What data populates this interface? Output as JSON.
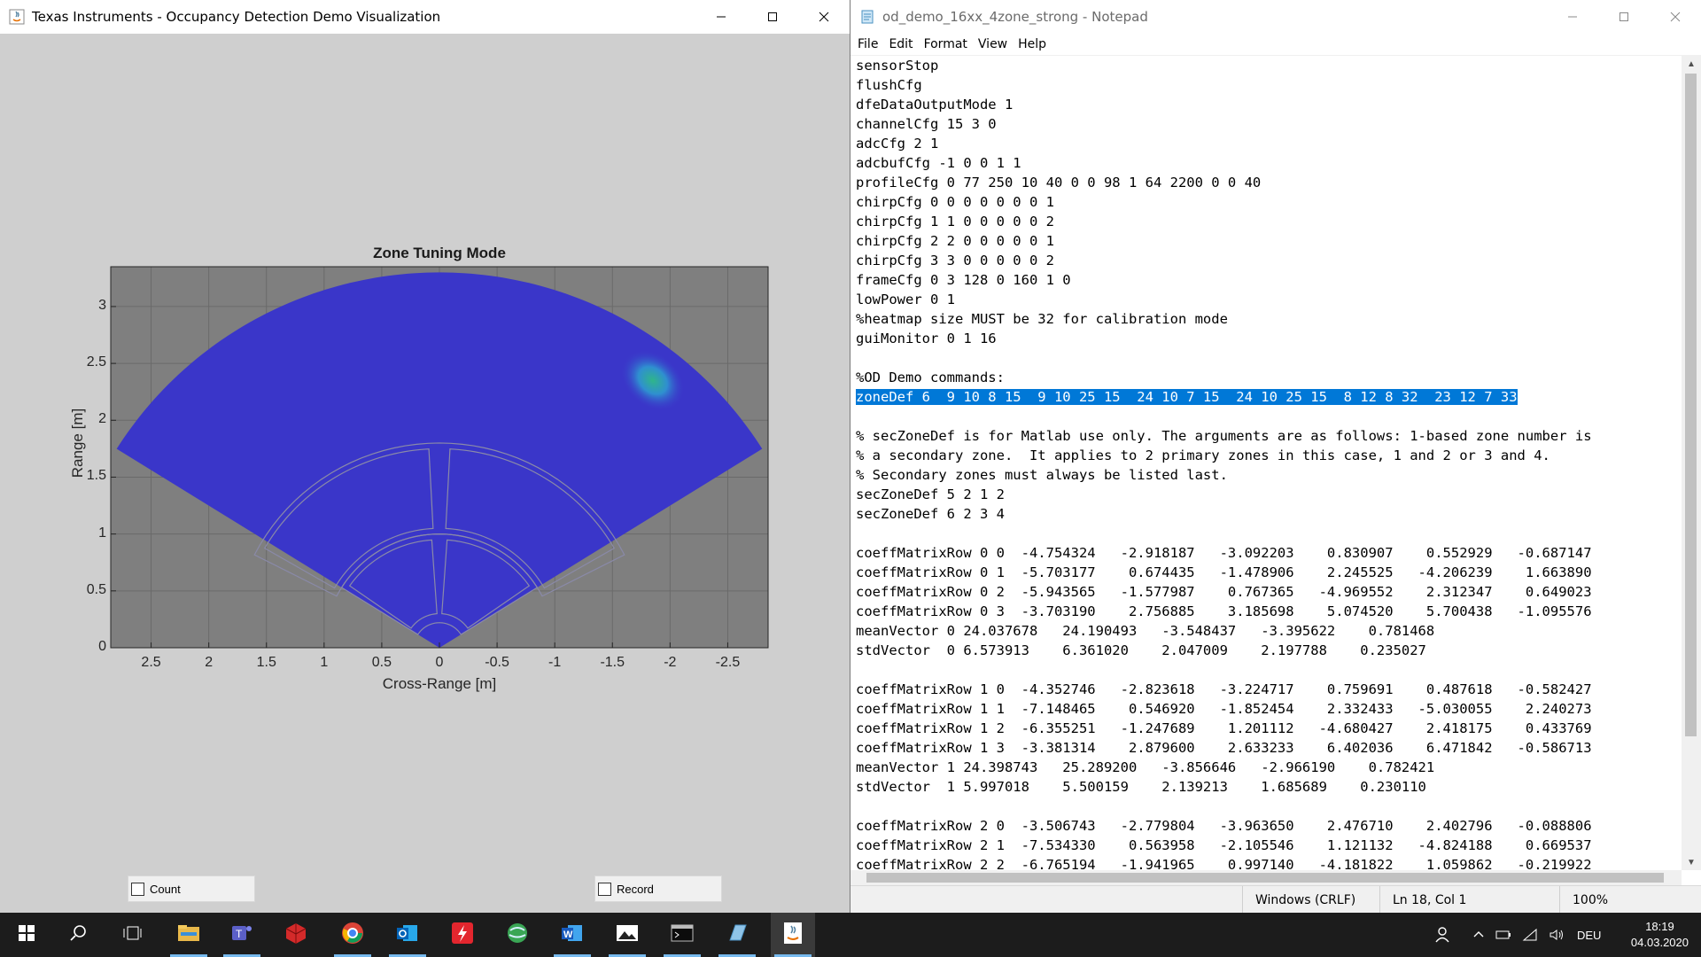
{
  "left_window": {
    "title": "Texas Instruments - Occupancy Detection Demo Visualization",
    "controls": {
      "minimize": "minimize",
      "maximize": "maximize",
      "close": "close"
    }
  },
  "chart_data": {
    "type": "heatmap",
    "title": "Zone Tuning Mode",
    "xlabel": "Cross-Range [m]",
    "ylabel": "Range [m]",
    "xlim": [
      2.85,
      -2.85
    ],
    "ylim": [
      0,
      3.35
    ],
    "x_ticks": [
      "2.5",
      "2",
      "1.5",
      "1",
      "0.5",
      "0",
      "-0.5",
      "-1",
      "-1.5",
      "-2",
      "-2.5"
    ],
    "x_tick_values": [
      2.5,
      2,
      1.5,
      1,
      0.5,
      0,
      -0.5,
      -1,
      -1.5,
      -2,
      -2.5
    ],
    "y_ticks": [
      "0",
      "0.5",
      "1",
      "1.5",
      "2",
      "2.5",
      "3"
    ],
    "y_tick_values": [
      0,
      0.5,
      1,
      1.5,
      2,
      2.5,
      3
    ],
    "grid": true,
    "sector": {
      "max_range": 3.3,
      "half_angle_deg": 58
    },
    "hotspot": {
      "x": -1.85,
      "y": 2.35
    },
    "zone_outlines": [
      {
        "r_min": 1.05,
        "r_max": 1.75,
        "angle_min_deg": -60,
        "angle_max_deg": -3
      },
      {
        "r_min": 1.05,
        "r_max": 1.75,
        "angle_min_deg": 3,
        "angle_max_deg": 60
      },
      {
        "r_min": 0.3,
        "r_max": 0.95,
        "angle_min_deg": -55,
        "angle_max_deg": -4
      },
      {
        "r_min": 0.3,
        "r_max": 0.95,
        "angle_min_deg": 4,
        "angle_max_deg": 55
      },
      {
        "r_min": 1.0,
        "r_max": 1.8,
        "angle_min_deg": -63,
        "angle_max_deg": 63
      },
      {
        "r_min": 0.22,
        "r_max": 1.0,
        "angle_min_deg": -58,
        "angle_max_deg": 58
      }
    ],
    "colors": {
      "background": "#7f7f7f",
      "field": "#3a36c9",
      "hot": "#2fb58a",
      "outline": "#8a8aa8"
    }
  },
  "checkboxes": {
    "count_label": "Count",
    "record_label": "Record"
  },
  "notepad": {
    "title": "od_demo_16xx_4zone_strong - Notepad",
    "menu": [
      "File",
      "Edit",
      "Format",
      "View",
      "Help"
    ],
    "lines": [
      "sensorStop",
      "flushCfg",
      "dfeDataOutputMode 1",
      "channelCfg 15 3 0",
      "adcCfg 2 1",
      "adcbufCfg -1 0 0 1 1",
      "profileCfg 0 77 250 10 40 0 0 98 1 64 2200 0 0 40",
      "chirpCfg 0 0 0 0 0 0 0 1",
      "chirpCfg 1 1 0 0 0 0 0 2",
      "chirpCfg 2 2 0 0 0 0 0 1",
      "chirpCfg 3 3 0 0 0 0 0 2",
      "frameCfg 0 3 128 0 160 1 0",
      "lowPower 0 1",
      "%heatmap size MUST be 32 for calibration mode",
      "guiMonitor 0 1 16",
      "",
      "%OD Demo commands:",
      "zoneDef 6  9 10 8 15  9 10 25 15  24 10 7 15  24 10 25 15  8 12 8 32  23 12 7 33",
      "",
      "% secZoneDef is for Matlab use only. The arguments are as follows: 1-based zone number is",
      "% a secondary zone.  It applies to 2 primary zones in this case, 1 and 2 or 3 and 4.",
      "% Secondary zones must always be listed last.",
      "secZoneDef 5 2 1 2",
      "secZoneDef 6 2 3 4",
      "",
      "coeffMatrixRow 0 0  -4.754324   -2.918187   -3.092203    0.830907    0.552929   -0.687147",
      "coeffMatrixRow 0 1  -5.703177    0.674435   -1.478906    2.245525   -4.206239    1.663890",
      "coeffMatrixRow 0 2  -5.943565   -1.577987    0.767365   -4.969552    2.312347    0.649023",
      "coeffMatrixRow 0 3  -3.703190    2.756885    3.185698    5.074520    5.700438   -1.095576",
      "meanVector 0 24.037678   24.190493   -3.548437   -3.395622    0.781468",
      "stdVector  0 6.573913    6.361020    2.047009    2.197788    0.235027",
      "",
      "coeffMatrixRow 1 0  -4.352746   -2.823618   -3.224717    0.759691    0.487618   -0.582427",
      "coeffMatrixRow 1 1  -7.148465    0.546920   -1.852454    2.332433   -5.030055    2.240273",
      "coeffMatrixRow 1 2  -6.355251   -1.247689    1.201112   -4.680427    2.418175    0.433769",
      "coeffMatrixRow 1 3  -3.381314    2.879600    2.633233    6.402036    6.471842   -0.586713",
      "meanVector 1 24.398743   25.289200   -3.856646   -2.966190    0.782421",
      "stdVector  1 5.997018    5.500159    2.139213    1.685689    0.230110",
      "",
      "coeffMatrixRow 2 0  -3.506743   -2.779804   -3.963650    2.476710    2.402796   -0.088806",
      "coeffMatrixRow 2 1  -7.534330    0.563958   -2.105546    1.121132   -4.824188    0.669537",
      "coeffMatrixRow 2 2  -6.765194   -1.941965    0.997140   -4.181822    1.059862   -0.219922"
    ],
    "selected_line": 17,
    "status": {
      "line_endings": "Windows (CRLF)",
      "position": "Ln 18, Col 1",
      "zoom": "100%"
    }
  },
  "taskbar": {
    "apps": [
      "start-icon",
      "search-icon",
      "task-view-icon",
      "file-explorer-icon",
      "teams-icon",
      "cube-app-icon",
      "chrome-icon",
      "outlook-icon",
      "flash-app-icon",
      "network-globe-icon",
      "word-icon",
      "photos-icon",
      "terminal-icon",
      "notepad-icon",
      "java-icon"
    ],
    "language": "DEU",
    "time": "18:19",
    "date": "04.03.2020"
  }
}
